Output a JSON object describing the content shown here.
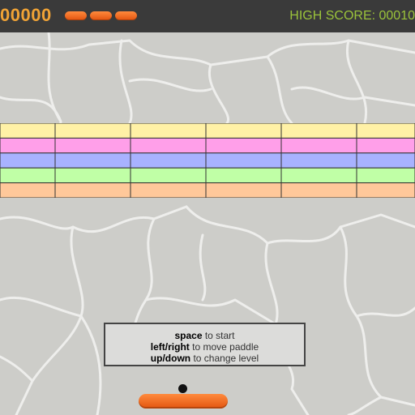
{
  "header": {
    "score": "00000",
    "lives": 3,
    "high_score_label": "HIGH SCORE: 00010"
  },
  "bricks": {
    "rows": [
      "#fff1a6",
      "#ff9fe9",
      "#a8b2ff",
      "#c0ffa6",
      "#ffc89a"
    ],
    "columns": 6
  },
  "instructions": {
    "line1_key": "space",
    "line1_text": " to start",
    "line2_key": "left/right",
    "line2_text": " to move paddle",
    "line3_key": "up/down",
    "line3_text": " to change level"
  },
  "colors": {
    "score": "#f0a336",
    "high_score": "#9bc33a",
    "paddle": "#f06a1e",
    "header_bg": "#3a3a3a"
  }
}
